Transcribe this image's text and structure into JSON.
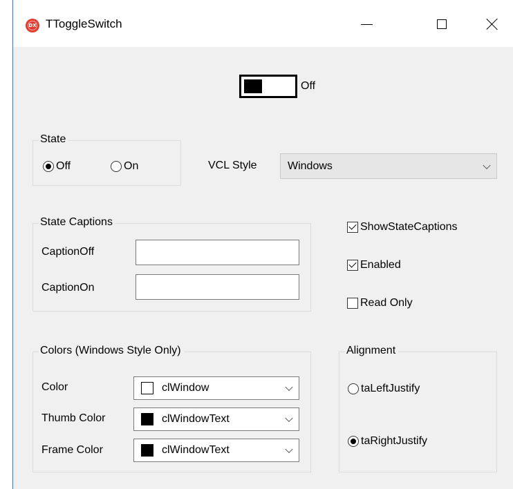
{
  "window": {
    "title": "TToggleSwitch",
    "app_icon_text": "DX"
  },
  "toggle": {
    "state": "off",
    "caption": "Off"
  },
  "state_group": {
    "title": "State",
    "options": [
      {
        "label": "Off",
        "selected": true
      },
      {
        "label": "On",
        "selected": false
      }
    ]
  },
  "vcl_style": {
    "label": "VCL Style",
    "value": "Windows"
  },
  "state_captions": {
    "title": "State Captions",
    "caption_off_label": "CaptionOff",
    "caption_off_value": "",
    "caption_on_label": "CaptionOn",
    "caption_on_value": ""
  },
  "options": {
    "show_state_captions": {
      "label": "ShowStateCaptions",
      "checked": true
    },
    "enabled": {
      "label": "Enabled",
      "checked": true
    },
    "read_only": {
      "label": "Read Only",
      "checked": false
    }
  },
  "colors": {
    "title": "Colors (Windows Style Only)",
    "color": {
      "label": "Color",
      "value": "clWindow",
      "swatch": "#ffffff"
    },
    "thumb_color": {
      "label": "Thumb Color",
      "value": "clWindowText",
      "swatch": "#000000"
    },
    "frame_color": {
      "label": "Frame Color",
      "value": "clWindowText",
      "swatch": "#000000"
    }
  },
  "alignment": {
    "title": "Alignment",
    "options": [
      {
        "label": "taLeftJustify",
        "selected": false
      },
      {
        "label": "taRightJustify",
        "selected": true
      }
    ]
  },
  "theme": {
    "window_bg": "#f0f0f0",
    "border_accent": "#2b79d6",
    "icon_red": "#e33b2f"
  }
}
